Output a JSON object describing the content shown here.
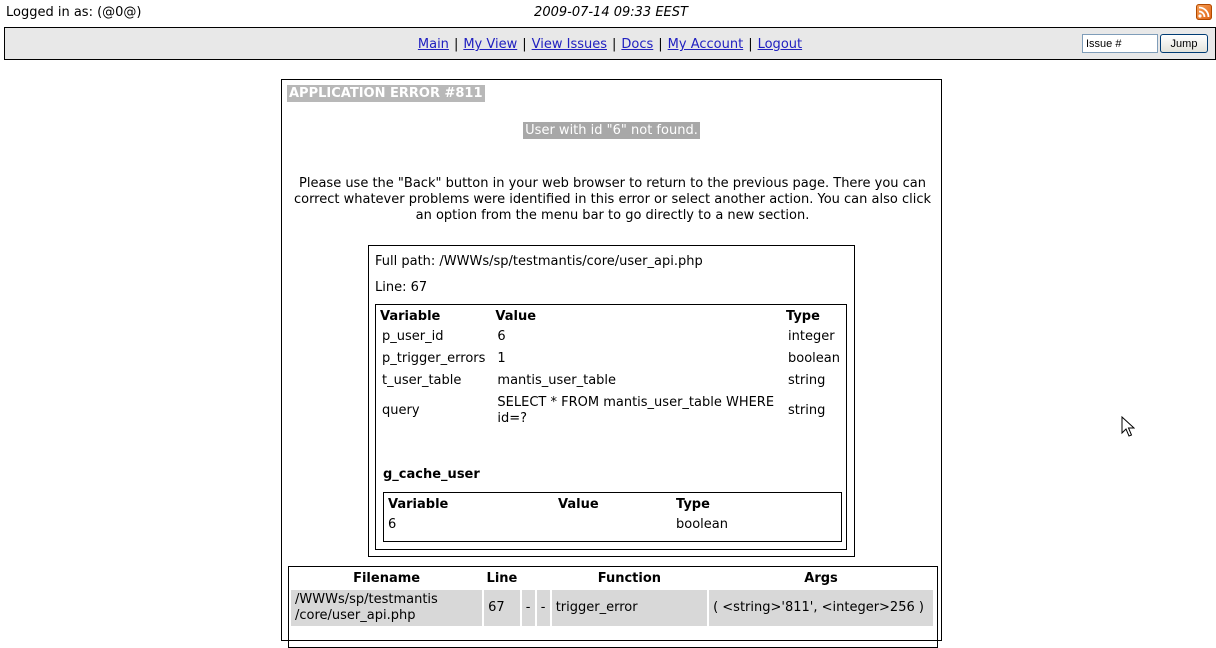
{
  "header": {
    "logged_in": "Logged in as: (@0@)",
    "datetime": "2009-07-14 09:33 EEST",
    "rss_icon": "rss-icon"
  },
  "menu": {
    "items": [
      "Main",
      "My View",
      "View Issues",
      "Docs",
      "My Account",
      "Logout"
    ],
    "separator": "|",
    "jump_placeholder": "Issue #",
    "jump_label": "Jump"
  },
  "error": {
    "title": "APPLICATION ERROR #811",
    "message": "User with id \"6\" not found.",
    "help": "Please use the \"Back\" button in your web browser to return to the previous page. There you can correct whatever problems were identified in this error or select another action. You can also click an option from the menu bar to go directly to a new section.",
    "full_path": "Full path: /WWWs/sp/testmantis/core/user_api.php",
    "line": "Line: 67",
    "variables": {
      "headers": [
        "Variable",
        "Value",
        "Type"
      ],
      "rows": [
        [
          "p_user_id",
          "6",
          "integer"
        ],
        [
          "p_trigger_errors",
          "1",
          "boolean"
        ],
        [
          "t_user_table",
          "mantis_user_table",
          "string"
        ],
        [
          "query",
          "SELECT * FROM mantis_user_table WHERE id=?",
          "string"
        ]
      ]
    },
    "cache": {
      "title": "g_cache_user",
      "headers": [
        "Variable",
        "Value",
        "Type"
      ],
      "rows": [
        [
          "6",
          "",
          "boolean"
        ]
      ]
    },
    "trace": {
      "headers": [
        "Filename",
        "Line",
        "",
        "",
        "Function",
        "Args"
      ],
      "rows": [
        [
          "/WWWs/sp/testmantis /core/user_api.php",
          "67",
          "-",
          "-",
          "trigger_error",
          "( <string>'811', <integer>256 )"
        ]
      ]
    }
  },
  "colors": {
    "menubar_bg": "#e8e8e8",
    "link": "#2020c0",
    "title_bg": "#b8b8b8",
    "row_bg": "#d8d8d8"
  }
}
